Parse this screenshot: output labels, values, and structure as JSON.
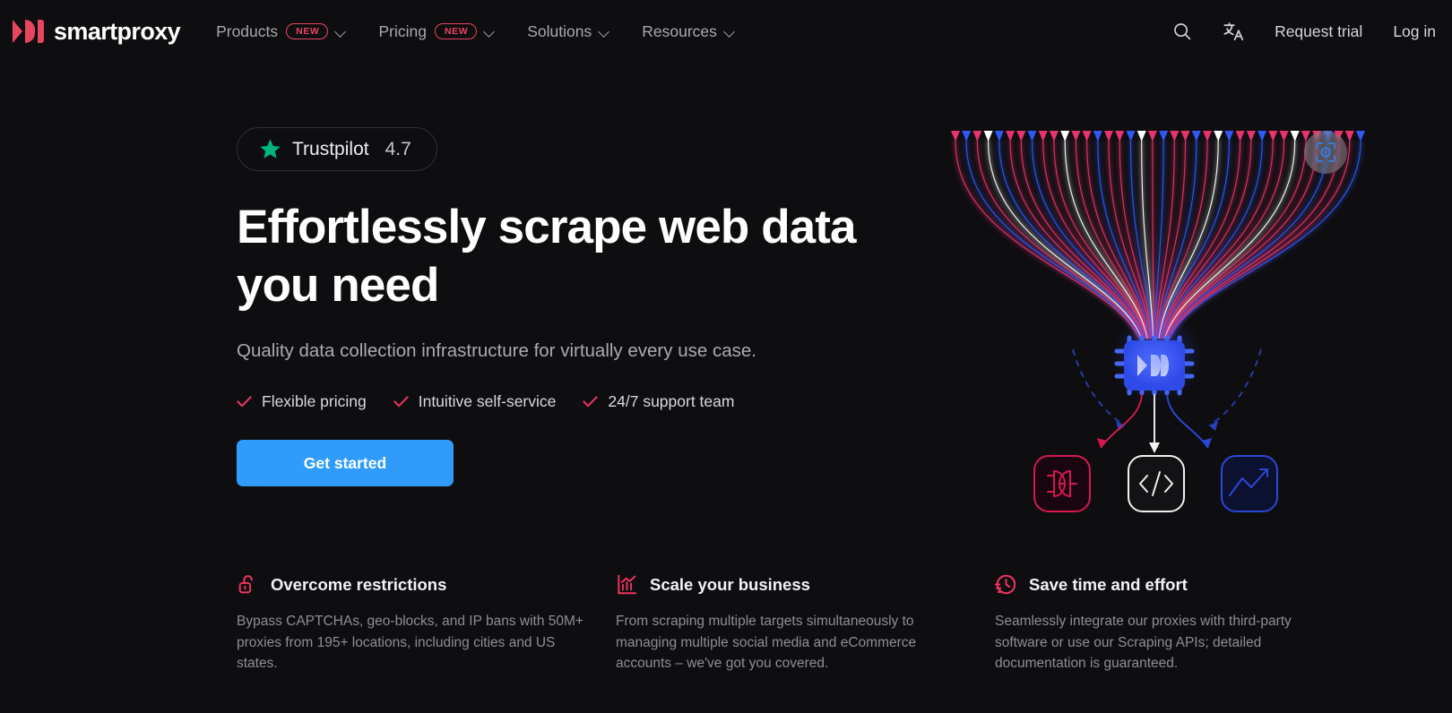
{
  "colors": {
    "background": "#0e0e11",
    "brand_pink": "#e8455f",
    "accent_blue": "#2f9bfa",
    "chip_blue": "#3456f5",
    "trustpilot_green": "#00b67a",
    "text_primary": "#ffffff",
    "text_muted": "#8c8f95"
  },
  "nav": {
    "brand": "smartproxy",
    "logo_icon": "smartproxy-logo-mark",
    "links": [
      {
        "label": "Products",
        "badge": "NEW",
        "has_dropdown": true
      },
      {
        "label": "Pricing",
        "badge": "NEW",
        "has_dropdown": true
      },
      {
        "label": "Solutions",
        "badge": "",
        "has_dropdown": true
      },
      {
        "label": "Resources",
        "badge": "",
        "has_dropdown": true
      }
    ],
    "search_icon": "search-icon",
    "language_icon": "translate-icon",
    "request_trial": "Request trial",
    "log_in": "Log in"
  },
  "hero": {
    "trustpilot": {
      "star_icon": "star-icon",
      "name": "Trustpilot",
      "score": "4.7"
    },
    "headline": "Effortlessly scrape web data you need",
    "subheadline": "Quality data collection infrastructure for virtually every use case.",
    "checks": [
      "Flexible pricing",
      "Intuitive self-service",
      "24/7 support team"
    ],
    "cta_label": "Get started"
  },
  "illustration": {
    "name": "data-collection-diagram",
    "chip_icon": "smartproxy-chip-icon",
    "badge_icon": "target-focus-icon",
    "outputs": [
      {
        "icon": "plug-connector-icon",
        "color": "#d4194f"
      },
      {
        "icon": "code-brackets-icon",
        "color": "#ffffff"
      },
      {
        "icon": "trend-chart-icon",
        "color": "#2b47d6"
      }
    ],
    "stream_colors": [
      "#e8336b",
      "#2f58f5",
      "#ffffff"
    ]
  },
  "features": [
    {
      "icon": "unlock-padlock-icon",
      "title": "Overcome restrictions",
      "body": "Bypass CAPTCHAs, geo-blocks, and IP bans with 50M+ proxies from 195+ locations, including cities and US states."
    },
    {
      "icon": "bar-chart-growth-icon",
      "title": "Scale your business",
      "body": "From scraping multiple targets simultaneously to managing multiple social media and eCommerce accounts – we've got you covered."
    },
    {
      "icon": "speed-clock-icon",
      "title": "Save time and effort",
      "body": "Seamlessly integrate our proxies with third-party software or use our Scraping APIs; detailed documentation is guaranteed."
    }
  ]
}
